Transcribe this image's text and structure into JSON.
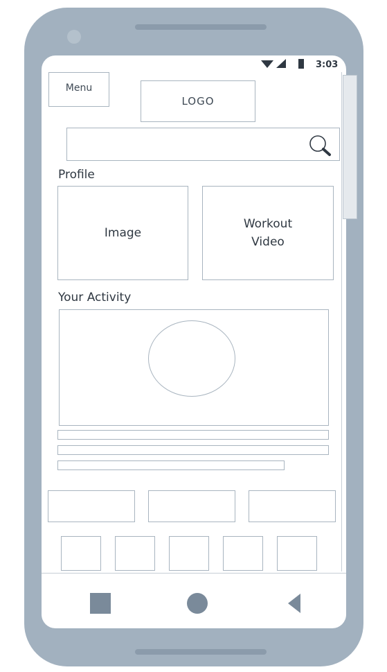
{
  "status_bar": {
    "time": "3:03"
  },
  "header": {
    "menu_label": "Menu",
    "logo_label": "LOGO"
  },
  "search": {
    "placeholder": ""
  },
  "profile": {
    "title": "Profile",
    "image_label": "Image",
    "video_label": "Workout Video"
  },
  "activity": {
    "title": "Your Activity"
  },
  "colors": {
    "phone_body": "#a2b1bf",
    "wireframe_stroke": "#a8b4bf",
    "nav_icons": "#7a8a9a"
  },
  "icons": {
    "status": [
      "wifi-icon",
      "signal-icon",
      "battery-icon"
    ],
    "search": "search-icon",
    "nav": [
      "recent-apps-icon",
      "home-icon",
      "back-icon"
    ]
  }
}
